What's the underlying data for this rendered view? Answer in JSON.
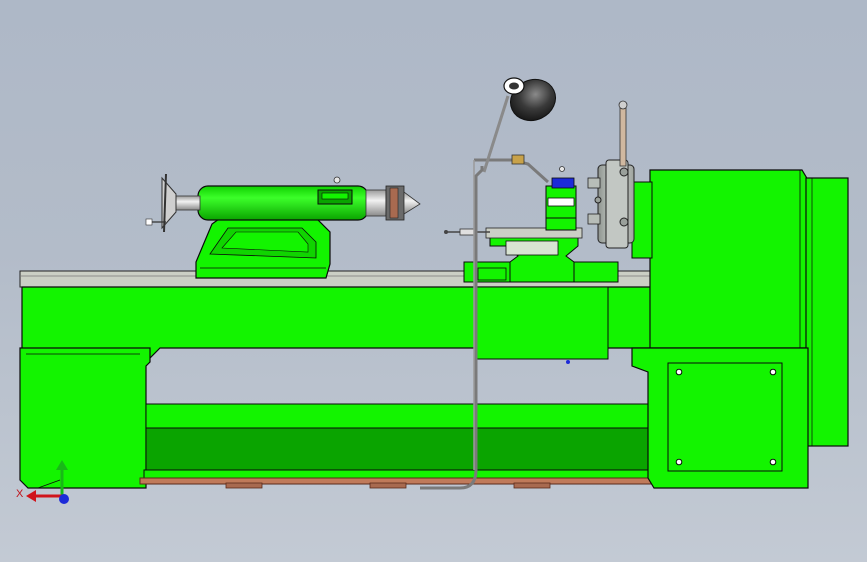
{
  "viewport": {
    "background_top": "#aeb8c7",
    "background_bottom": "#c3cad4"
  },
  "colors": {
    "body_green": "#13f400",
    "dark_green": "#0aa400",
    "mid_green": "#10d400",
    "outline": "#0a0a0a",
    "rail_gray": "#cbcfc5",
    "chuck_gray": "#c2c7c3",
    "steel": "#dcdcdc",
    "lamp_black": "#2c2c2c",
    "copper": "#a86a50",
    "axis_x": "#d0141c",
    "axis_y": "#18b818",
    "axis_z": "#1c2ad8"
  },
  "icons": [
    "lathe-model",
    "coordinate-triad-icon"
  ],
  "triad": {
    "x_label": "X"
  }
}
